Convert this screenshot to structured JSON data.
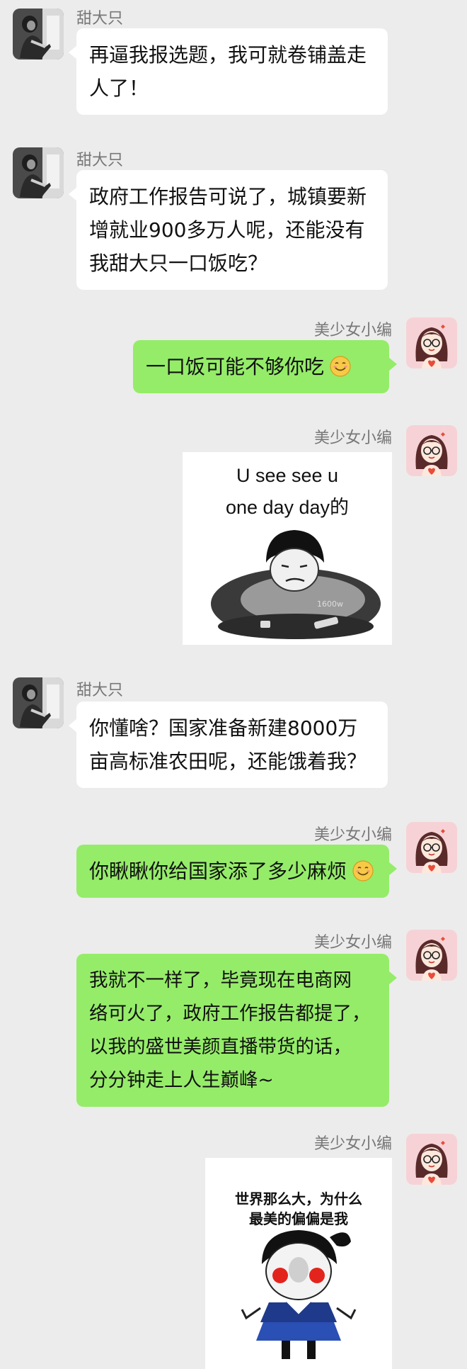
{
  "contacts": {
    "left_name": "甜大只",
    "right_name": "美少女小编"
  },
  "messages": [
    {
      "side": "left",
      "sender": "甜大只",
      "type": "text",
      "lines": [
        "再逼我报选题，我可就卷铺盖走",
        "人了！"
      ]
    },
    {
      "side": "left",
      "sender": "甜大只",
      "type": "text",
      "lines": [
        "政府工作报告可说了，城镇要新",
        "增就业900多万人呢，还能没有",
        "我甜大只一口饭吃？"
      ]
    },
    {
      "side": "right",
      "sender": "美少女小编",
      "type": "text",
      "lines": [
        "一口饭可能不够你吃"
      ],
      "emoji": "smile-emoji"
    },
    {
      "side": "right",
      "sender": "美少女小编",
      "type": "sticker",
      "caption_lines": [
        "U see see u",
        "one day day的"
      ]
    },
    {
      "side": "left",
      "sender": "甜大只",
      "type": "text",
      "lines": [
        "你懂啥？国家准备新建8000万",
        "亩高标准农田呢，还能饿着我？"
      ]
    },
    {
      "side": "right",
      "sender": "美少女小编",
      "type": "text",
      "lines": [
        "你瞅瞅你给国家添了多少麻烦"
      ],
      "emoji": "smile-emoji"
    },
    {
      "side": "right",
      "sender": "美少女小编",
      "type": "text",
      "lines": [
        "我就不一样了，毕竟现在电商网",
        "络可火了，政府工作报告都提了，",
        "以我的盛世美颜直播带货的话，",
        "分分钟走上人生巅峰~"
      ]
    },
    {
      "side": "right",
      "sender": "美少女小编",
      "type": "sticker",
      "caption_lines": [
        "世界那么大，为什么",
        "最美的偏偏是我"
      ]
    }
  ],
  "colors": {
    "background": "#ececec",
    "incoming_bubble": "#ffffff",
    "outgoing_bubble": "#95ec69",
    "sender_name": "#777777",
    "avatar_right_bg": "#f6d2d6"
  }
}
